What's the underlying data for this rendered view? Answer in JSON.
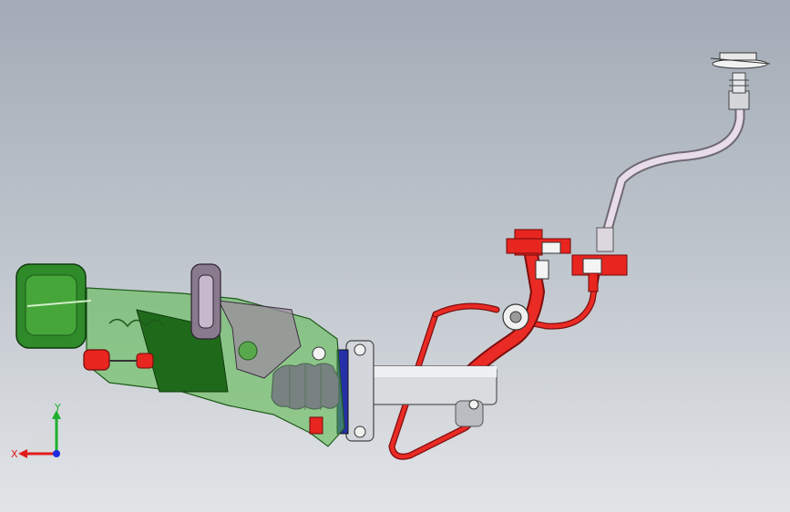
{
  "viewport": {
    "background_top": "#a2abb6",
    "background_bottom": "#e2e4e7"
  },
  "model": {
    "parts": [
      {
        "name": "pedal-bracket-assembly",
        "color": "#3aa33a"
      },
      {
        "name": "pedal-pad",
        "color": "#3d9b3d"
      },
      {
        "name": "clevis-pin",
        "color": "#e0201e"
      },
      {
        "name": "rubber-boot",
        "color": "#a23fc8"
      },
      {
        "name": "mounting-flange",
        "color": "#d7d9de"
      },
      {
        "name": "master-cylinder-body",
        "color": "#d8dade"
      },
      {
        "name": "reservoir-hose",
        "color": "#e8251f"
      },
      {
        "name": "fluid-line",
        "color": "#e8251f"
      },
      {
        "name": "upper-tube",
        "color": "#e6dbe9"
      },
      {
        "name": "top-fitting",
        "color": "#cfd2d6"
      }
    ]
  },
  "triad": {
    "x_label": "X",
    "y_label": "Y",
    "x_color": "#e11c1c",
    "y_color": "#1fae2f",
    "z_color": "#1c2ce0"
  }
}
